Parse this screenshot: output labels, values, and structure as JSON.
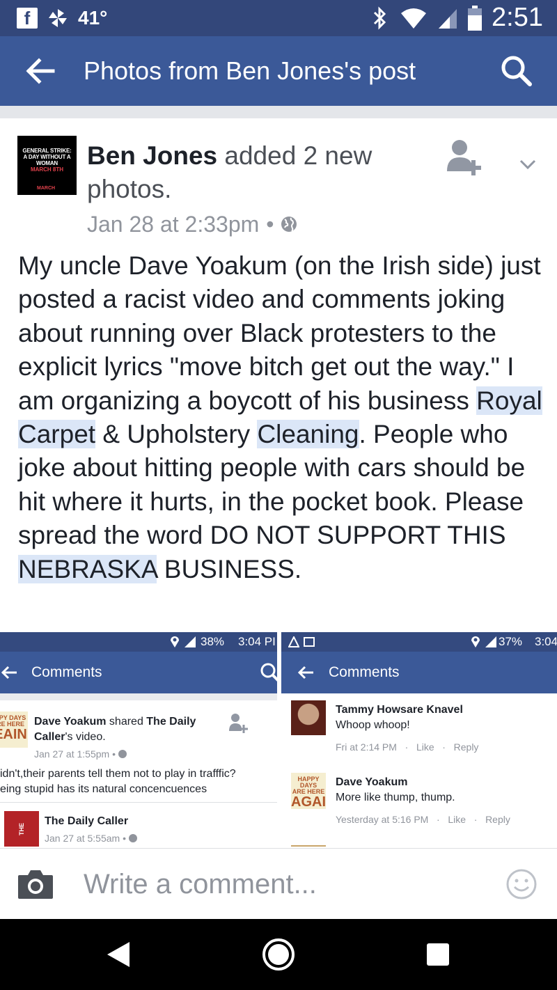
{
  "status_bar": {
    "temperature": "41°",
    "time": "2:51"
  },
  "app_bar": {
    "title": "Photos from Ben Jones's post"
  },
  "post": {
    "avatar_text": {
      "line1": "GENERAL STRIKE:",
      "line2": "A DAY WITHOUT A WOMAN",
      "line3": "MARCH 8TH",
      "line4": "MARCH"
    },
    "author": "Ben Jones",
    "action": " added 2 new photos.",
    "date": "Jan 28 at 2:33pm",
    "date_sep": "•",
    "body": [
      "My uncle Dave Yoakum (on the Irish side) just posted a racist video and comments joking about running over Black protesters to the explicit lyrics \"move bitch get out the way.\" I am organizing a boycott of his business ",
      "Royal Carpet",
      " & Upholstery ",
      "Cleaning",
      ". People who joke about hitting people with cars should be hit where it hurts, in the pocket book. Please spread the word DO NOT SUPPORT THIS ",
      "NEBRASKA",
      " BUSINESS."
    ]
  },
  "photo_left": {
    "status": "38%",
    "status_time": "3:04 PI",
    "title": "Comments",
    "shared_by": "Dave Yoakum",
    "shared_mid": " shared ",
    "shared_src": "The Daily",
    "shared_line2a": "Caller",
    "shared_line2b": "'s video.",
    "shared_date": "Jan 27 at 1:55pm • ",
    "comment_line1": "idn't,their parents tell them not to play in trafffic?",
    "comment_line2": "eing stupid has its natural concencuences",
    "source_name": "The Daily Caller",
    "source_date": "Jan 27 at 5:55am • ",
    "source_logo": "DC",
    "source_logo_prefix": "THE",
    "avatar_text": {
      "line1": "PPY DAYS",
      "line2": "RE HERE",
      "line3": "EAIN"
    }
  },
  "photo_right": {
    "status": "37%",
    "status_time": "3:04",
    "title": "Comments",
    "comments": [
      {
        "name": "Tammy Howsare Knavel",
        "text": "Whoop whoop!",
        "time": "Fri at 2:14 PM",
        "like": "Like",
        "reply": "Reply"
      },
      {
        "name": "Dave Yoakum",
        "text": "More like thump, thump.",
        "time": "Yesterday at 5:16 PM",
        "like": "Like",
        "reply": "Reply"
      }
    ],
    "dot": "·",
    "avatar_text": {
      "line1": "HAPPY DAYS",
      "line2": "ARE HERE",
      "line3": "AGAIN"
    }
  },
  "composer": {
    "placeholder": "Write a comment..."
  },
  "colors": {
    "facebook_blue": "#3b5998",
    "status_blue": "#33477a",
    "highlight": "#dbe6f7",
    "meta_gray": "#90949c"
  }
}
